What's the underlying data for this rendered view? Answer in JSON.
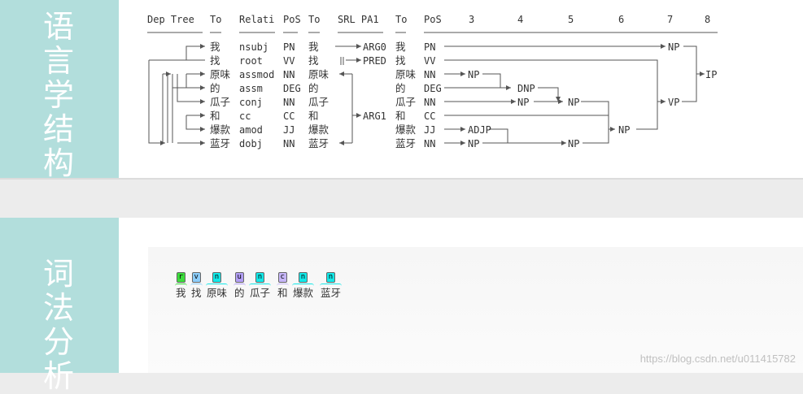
{
  "sections": {
    "structure_title": "语言学结构",
    "lexical_title": "词法分析"
  },
  "table": {
    "headers": [
      "Dep Tree",
      "To",
      "Relati",
      "PoS",
      "To",
      "SRL PA1",
      "To",
      "PoS",
      "3",
      "4",
      "5",
      "6",
      "7",
      "8"
    ],
    "words": [
      "我",
      "找",
      "原味",
      "的",
      "瓜子",
      "和",
      "爆款",
      "蓝牙"
    ],
    "relations": [
      "nsubj",
      "root",
      "assmod",
      "assm",
      "conj",
      "cc",
      "amod",
      "dobj"
    ],
    "pos": [
      "PN",
      "VV",
      "NN",
      "DEG",
      "NN",
      "CC",
      "JJ",
      "NN"
    ],
    "srl_labels": [
      "ARG0",
      "PRED",
      "ARG1"
    ],
    "phrase_labels": {
      "np_row0": "NP",
      "ip": "IP",
      "np_row2": "NP",
      "dnp": "DNP",
      "np_row4_c4": "NP",
      "np_row4_c5": "NP",
      "vp": "VP",
      "adjp": "ADJP",
      "np_row7_c3": "NP",
      "np_row7_c5": "NP",
      "np_c6": "NP"
    }
  },
  "lexical": {
    "tokens": [
      {
        "word": "我",
        "tag": "r",
        "color": "#3cdc3c"
      },
      {
        "word": "找",
        "tag": "v",
        "color": "#8ccdfa"
      },
      {
        "word": "原味",
        "tag": "n",
        "color": "#12e8e8"
      },
      {
        "word": "的",
        "tag": "u",
        "color": "#b29ef5"
      },
      {
        "word": "瓜子",
        "tag": "n",
        "color": "#12e8e8"
      },
      {
        "word": "和",
        "tag": "c",
        "color": "#c6b6f8"
      },
      {
        "word": "爆款",
        "tag": "n",
        "color": "#12e8e8"
      },
      {
        "word": "蓝牙",
        "tag": "n",
        "color": "#12e8e8"
      }
    ]
  },
  "watermark": "https://blog.csdn.net/u011415782"
}
